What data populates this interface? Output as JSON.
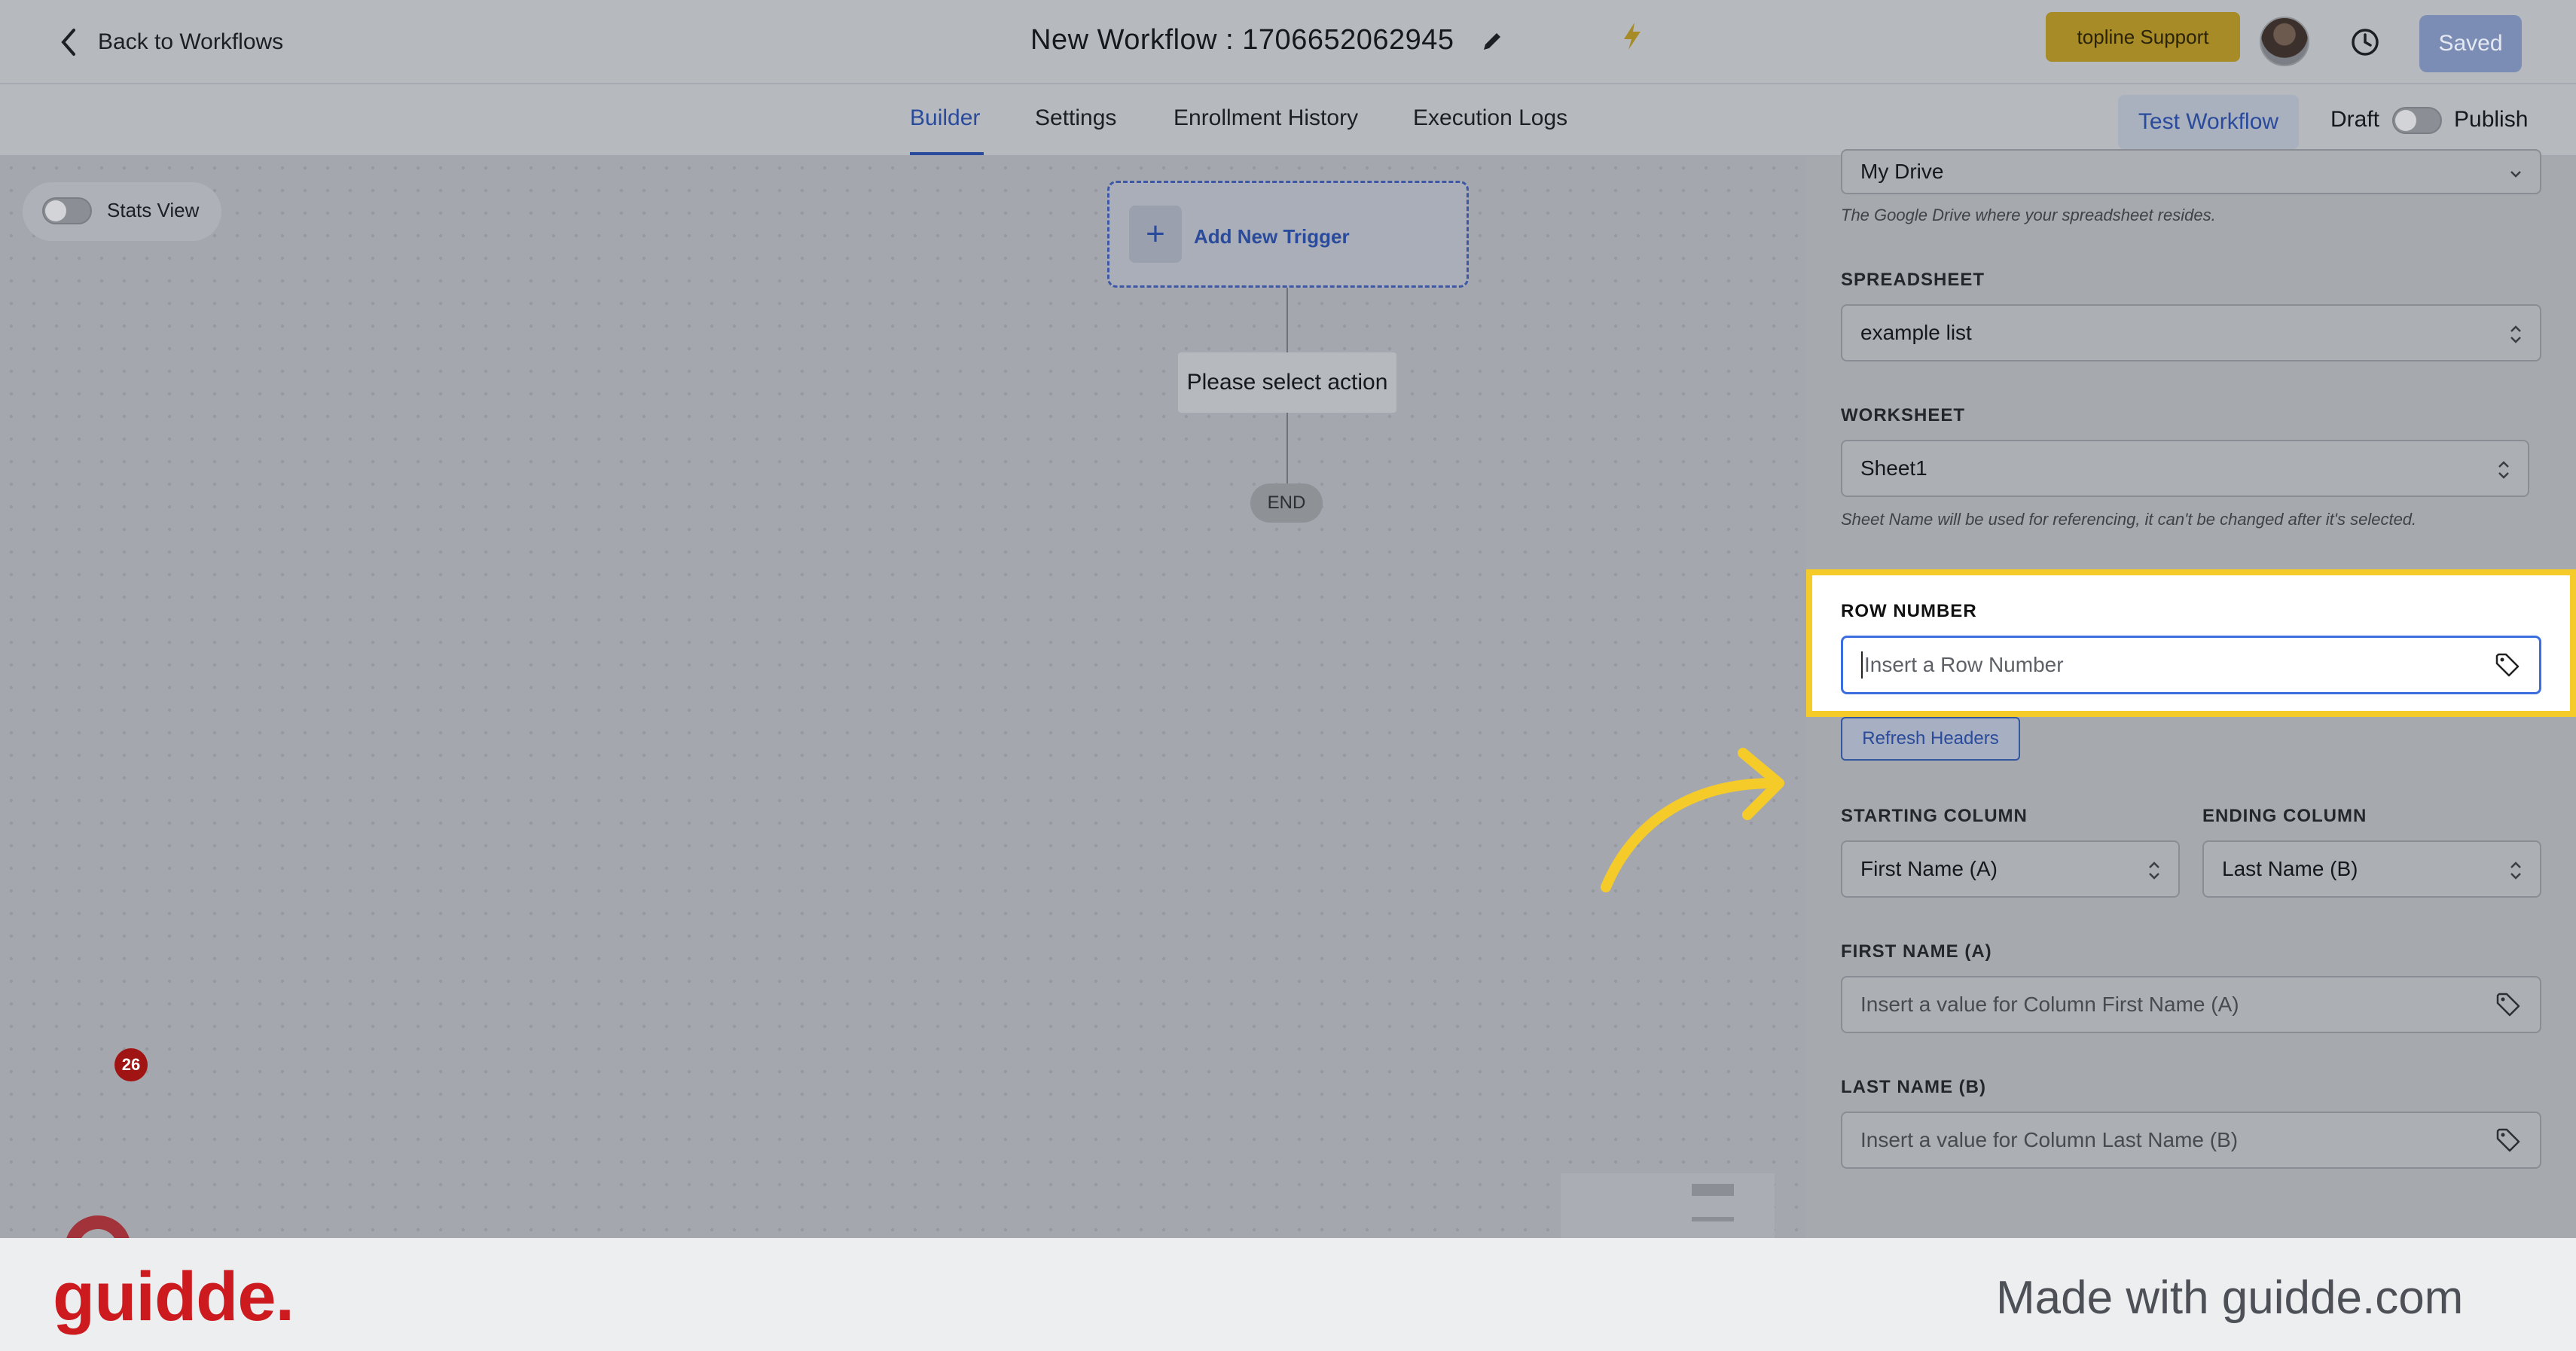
{
  "header": {
    "back_label": "Back to Workflows",
    "title": "New Workflow : 1706652062945",
    "support_label": "topline Support",
    "saved_label": "Saved"
  },
  "tabs": [
    {
      "label": "Builder",
      "active": true
    },
    {
      "label": "Settings",
      "active": false
    },
    {
      "label": "Enrollment History",
      "active": false
    },
    {
      "label": "Execution Logs",
      "active": false
    }
  ],
  "toolbar": {
    "test_label": "Test Workflow",
    "draft_label": "Draft",
    "publish_label": "Publish"
  },
  "canvas": {
    "stats_label": "Stats View",
    "trigger_label": "Add New Trigger",
    "action_label": "Please select action",
    "end_label": "END",
    "notification_count": "26"
  },
  "panel": {
    "drive_value": "My Drive",
    "drive_hint": "The Google Drive where your spreadsheet resides.",
    "spreadsheet_label": "SPREADSHEET",
    "spreadsheet_value": "example list",
    "worksheet_label": "WORKSHEET",
    "worksheet_value": "Sheet1",
    "worksheet_hint": "Sheet Name will be used for referencing, it can't be changed after it's selected.",
    "row_label": "ROW NUMBER",
    "row_placeholder": "Insert a Row Number",
    "refresh_label": "Refresh Headers",
    "start_col_label": "STARTING COLUMN",
    "start_col_value": "First Name (A)",
    "end_col_label": "ENDING COLUMN",
    "end_col_value": "Last Name (B)",
    "first_name_label": "FIRST NAME (A)",
    "first_name_placeholder": "Insert a value for Column First Name (A)",
    "last_name_label": "LAST NAME (B)",
    "last_name_placeholder": "Insert a value for Column Last Name  (B)"
  },
  "footer": {
    "logo": "guidde.",
    "made_with": "Made with guidde.com"
  },
  "colors": {
    "accent": "#2a4a9b",
    "highlight": "#f5cb2a",
    "brand": "#cc1a1f"
  }
}
